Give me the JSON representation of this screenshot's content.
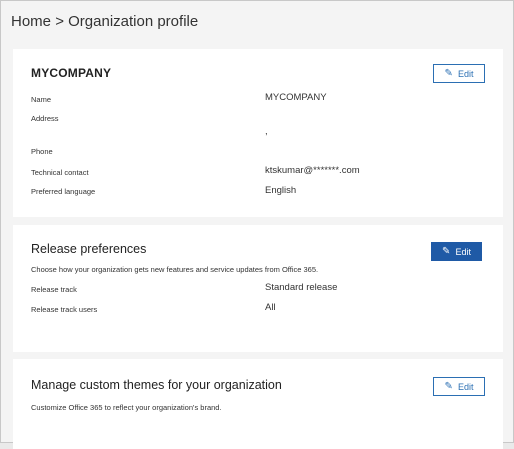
{
  "breadcrumb": {
    "home": "Home",
    "separator": ">",
    "current": "Organization profile"
  },
  "organization_card": {
    "title": "MYCOMPANY",
    "edit_label": "Edit",
    "rows": [
      {
        "label": "Name",
        "value": "MYCOMPANY"
      },
      {
        "label": "Address",
        "value": ""
      },
      {
        "label": "",
        "value": ","
      },
      {
        "label": "Phone",
        "value": ""
      },
      {
        "label": "Technical contact",
        "value": "ktskumar@*******.com"
      },
      {
        "label": "Preferred language",
        "value": "English"
      }
    ]
  },
  "release_card": {
    "title": "Release preferences",
    "edit_label": "Edit",
    "description": "Choose how your organization gets new features and service updates from Office 365.",
    "rows": [
      {
        "label": "Release track",
        "value": "Standard release"
      },
      {
        "label": "Release track users",
        "value": "All"
      }
    ]
  },
  "themes_card": {
    "title": "Manage custom themes for your organization",
    "edit_label": "Edit",
    "description": "Customize Office 365 to reflect your organization's brand."
  },
  "icons": {
    "edit": "pencil-icon"
  },
  "colors": {
    "accent": "#1f5aa6",
    "page_bg": "#f4f4f4",
    "card_bg": "#ffffff"
  }
}
